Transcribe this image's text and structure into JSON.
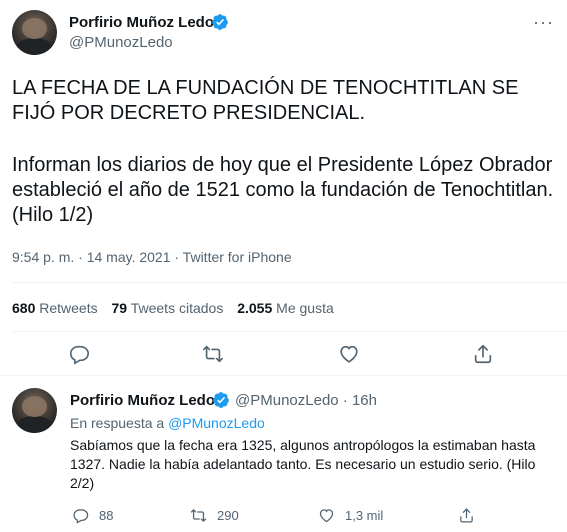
{
  "main": {
    "display_name": "Porfirio Muñoz Ledo",
    "handle": "@PMunozLedo",
    "more_label": "···",
    "text_para1": "LA FECHA DE LA FUNDACIÓN DE TENOCHTITLAN SE FIJÓ POR DECRETO PRESIDENCIAL.",
    "text_para2": "Informan los diarios de hoy que el Presidente López Obrador estableció el año de 1521 como la fundación de Tenochtitlan. (Hilo 1/2)",
    "meta": "9:54 p. m. · 14 may. 2021 · Twitter for iPhone",
    "stats": {
      "retweets_count": "680",
      "retweets_label": "Retweets",
      "quotes_count": "79",
      "quotes_label": "Tweets citados",
      "likes_count": "2.055",
      "likes_label": "Me gusta"
    },
    "actions": [
      "reply-icon",
      "retweet-icon",
      "like-icon",
      "share-icon"
    ]
  },
  "reply": {
    "display_name": "Porfirio Muñoz Ledo",
    "handle_time": "@PMunozLedo · 16h",
    "reply_prefix": "En respuesta a",
    "reply_handle": "@PMunozLedo",
    "text": "Sabíamos que la fecha era 1325, algunos antropólogos la estimaban hasta 1327. Nadie la había adelantado tanto. Es necesario un estudio serio. (Hilo 2/2)",
    "reply_count": "88",
    "retweet_count": "290",
    "like_count": "1,3 mil"
  },
  "colors": {
    "accent": "#1d9bf0",
    "text": "#0f1419",
    "muted": "#536471"
  }
}
